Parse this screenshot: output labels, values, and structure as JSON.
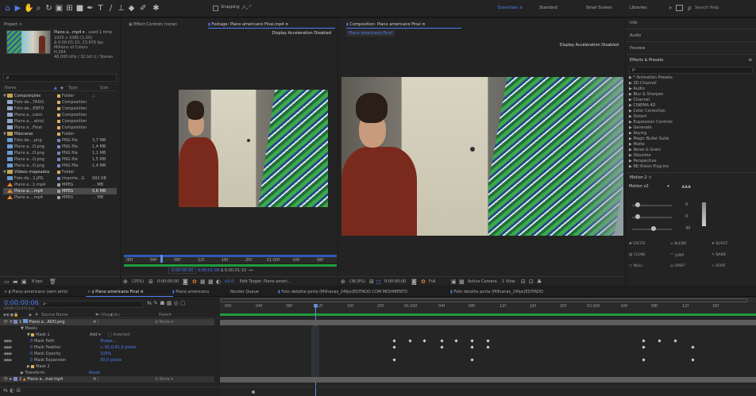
{
  "toolbar": {
    "snapping_label": "Snapping",
    "workspaces": [
      "Essentials",
      "Standard",
      "Small Screen",
      "Libraries"
    ],
    "overflow": "»",
    "search_placeholder": "Search Help"
  },
  "project": {
    "title": "Project",
    "selected_file": "Plano a...mp4",
    "used_count": ", used 1 time",
    "meta": [
      "1920 x 1080 (1,00)",
      "Δ 0:00:01:10, 23,976 fps",
      "Millions of Colors",
      "H.264",
      "48,000 kHz / 32 bit U / Stereo"
    ],
    "search_icon": "ρ",
    "columns": {
      "name": "Name",
      "type": "Type",
      "size": "Size"
    },
    "items": [
      {
        "name": "Composições",
        "type": "Folder",
        "size": "",
        "kind": "folder",
        "depth": 0
      },
      {
        "name": "Foto de...TADO",
        "type": "Composition",
        "size": "",
        "kind": "comp",
        "depth": 1
      },
      {
        "name": "Foto de...ENTO",
        "type": "Composition",
        "size": "",
        "kind": "comp",
        "depth": 1
      },
      {
        "name": "Plano a...cano",
        "type": "Composition",
        "size": "",
        "kind": "comp",
        "depth": 1
      },
      {
        "name": "Plano a... atriz)",
        "type": "Composition",
        "size": "",
        "kind": "comp",
        "depth": 1
      },
      {
        "name": "Plano a...Final",
        "type": "Composition",
        "size": "",
        "kind": "comp",
        "depth": 1
      },
      {
        "name": "Máscaras",
        "type": "Folder",
        "size": "",
        "kind": "folder",
        "depth": 0
      },
      {
        "name": "Foto de....png",
        "type": "PNG file",
        "size": "3,7 MB",
        "kind": "png",
        "depth": 1
      },
      {
        "name": "Plano a...O.png",
        "type": "PNG file",
        "size": "1,4 MB",
        "kind": "png",
        "depth": 1
      },
      {
        "name": "Plano a...O.png",
        "type": "PNG file",
        "size": "1,1 MB",
        "kind": "png",
        "depth": 1
      },
      {
        "name": "Plano a...O.png",
        "type": "PNG file",
        "size": "1,5 MB",
        "kind": "png",
        "depth": 1
      },
      {
        "name": "Plano a...O.png",
        "type": "PNG File",
        "size": "1,4 MB",
        "kind": "png",
        "depth": 1
      },
      {
        "name": "Vídeos mapeados",
        "type": "Folder",
        "size": "",
        "kind": "folder",
        "depth": 0
      },
      {
        "name": "Foto de...1.JPG",
        "type": "Importe...G",
        "size": "992 KB",
        "kind": "png",
        "depth": 1
      },
      {
        "name": "Plano a...1.mp4",
        "type": "MPEG",
        "size": "... MB",
        "kind": "mpeg",
        "depth": 1
      },
      {
        "name": "Plano a....mp4",
        "type": "MPEG",
        "size": "5,6 MB",
        "kind": "mpeg",
        "depth": 1,
        "selected": true
      },
      {
        "name": "Plano a....mp4",
        "type": "MPEG",
        "size": "... MB",
        "kind": "mpeg",
        "depth": 1
      }
    ],
    "bpc": "8 bpc"
  },
  "effect_controls": {
    "title": "Effect Controls (none)"
  },
  "footage": {
    "title": "Footage: Plano americano Final.mp4",
    "menu": "≡",
    "banner": "Display Acceleration Disabled",
    "ruler": [
      "00f",
      "04f",
      "08f",
      "12f",
      "16f",
      "20f",
      "01:00f",
      "04f",
      "08f"
    ],
    "in_time": "0:00:00:00",
    "out_time": "0:00:01:09",
    "dur_time": "Δ 0:00:01:10",
    "zoom": "(25%)",
    "timecode": "0:00:00:00",
    "exposure": "+0,0",
    "edit_target": "Edit Target: Plano ameri..."
  },
  "composition": {
    "title": "Composition: Plano americano Final",
    "menu": "≡",
    "tab": "Plano americano Final",
    "banner": "Display Acceleration Disabled",
    "zoom": "(36,9%)",
    "timecode": "0:00:00:00",
    "resolution": "Full",
    "camera": "Active Camera",
    "views": "1 View",
    "exposure": "+0,0"
  },
  "right_panel": {
    "sections": [
      "Info",
      "Audio",
      "Preview"
    ],
    "effects_title": "Effects & Presets",
    "menu": "≡",
    "search": "ρ–",
    "effects": [
      "* Animation Presets",
      "3D Channel",
      "Audio",
      "Blur & Sharpen",
      "Channel",
      "CINEMA 4D",
      "Color Correction",
      "Distort",
      "Expression Controls",
      "Generate",
      "Keying",
      "Magic Bullet Suite",
      "Matte",
      "Noise & Grain",
      "Obsolete",
      "Perspective",
      "RE:Vision Plug-ins"
    ],
    "motion_title": "Motion 2",
    "motion_panel": "Motion v2",
    "motion_value": "0",
    "motion_value2": "0",
    "motion_value3": "30",
    "motion_buttons": [
      [
        "EXCITE",
        "BLEND",
        "BURST"
      ],
      [
        "CLONE",
        "JUMP",
        "NAME"
      ],
      [
        "NULL",
        "ORBIT",
        "ROPE"
      ]
    ]
  },
  "timeline": {
    "tabs": [
      "Plano americano (sem atriz)",
      "Plano americano Final",
      "Plano americano",
      "Render Queue",
      "Foto detalhe porta (Milhanas_24fps)EDITADO COM MOVIMENTO",
      "Foto detalhe porta (Milhanas_24fps)EDITADO"
    ],
    "active_tab": 1,
    "timecode": "0:00:00:06",
    "fps": "00006 (23.976 fps)",
    "search": "ρ–",
    "col_source": "Source Name",
    "col_parent": "Parent",
    "ruler": [
      "00f",
      "04f",
      "08f",
      "12f",
      "16f",
      "20f",
      "01:00f",
      "04f",
      "08f",
      "12f",
      "16f",
      "20f",
      "02:00f",
      "04f",
      "08f",
      "12f",
      "16f"
    ],
    "layers": [
      {
        "label": "▼",
        "num": "1",
        "name": "Plano a...ADO.png",
        "parent": "None",
        "kind": "layer"
      },
      {
        "label": "▼",
        "num": "",
        "name": "Masks",
        "kind": "group"
      },
      {
        "label": "▼",
        "num": "",
        "name": "Mask 1",
        "kind": "mask",
        "mode": "Add",
        "inverted": "Inverted"
      },
      {
        "label": "",
        "num": "",
        "name": "Mask Path",
        "value": "Shape...",
        "kind": "prop"
      },
      {
        "label": "",
        "num": "",
        "name": "Mask Feather",
        "value": "∞ 91,0,91,0 pixels",
        "kind": "prop"
      },
      {
        "label": "",
        "num": "",
        "name": "Mask Opacity",
        "value": "100%",
        "kind": "prop"
      },
      {
        "label": "",
        "num": "",
        "name": "Mask Expansion",
        "value": "30,0 pixels",
        "kind": "prop"
      },
      {
        "label": "▶",
        "num": "",
        "name": "Mask 2",
        "kind": "mask"
      },
      {
        "label": "▶",
        "num": "",
        "name": "Transform",
        "value": "Reset",
        "kind": "group"
      },
      {
        "label": "▶",
        "num": "2",
        "name": "Plano a...inal.mp4",
        "parent": "None",
        "kind": "layer"
      }
    ],
    "colors": {
      "accent": "#4f7df5",
      "work_area": "#2d5ab8",
      "playhead": "#5e8fd6",
      "selected": "#3e3e3e",
      "layer_bar": "#5f5f5f"
    }
  }
}
